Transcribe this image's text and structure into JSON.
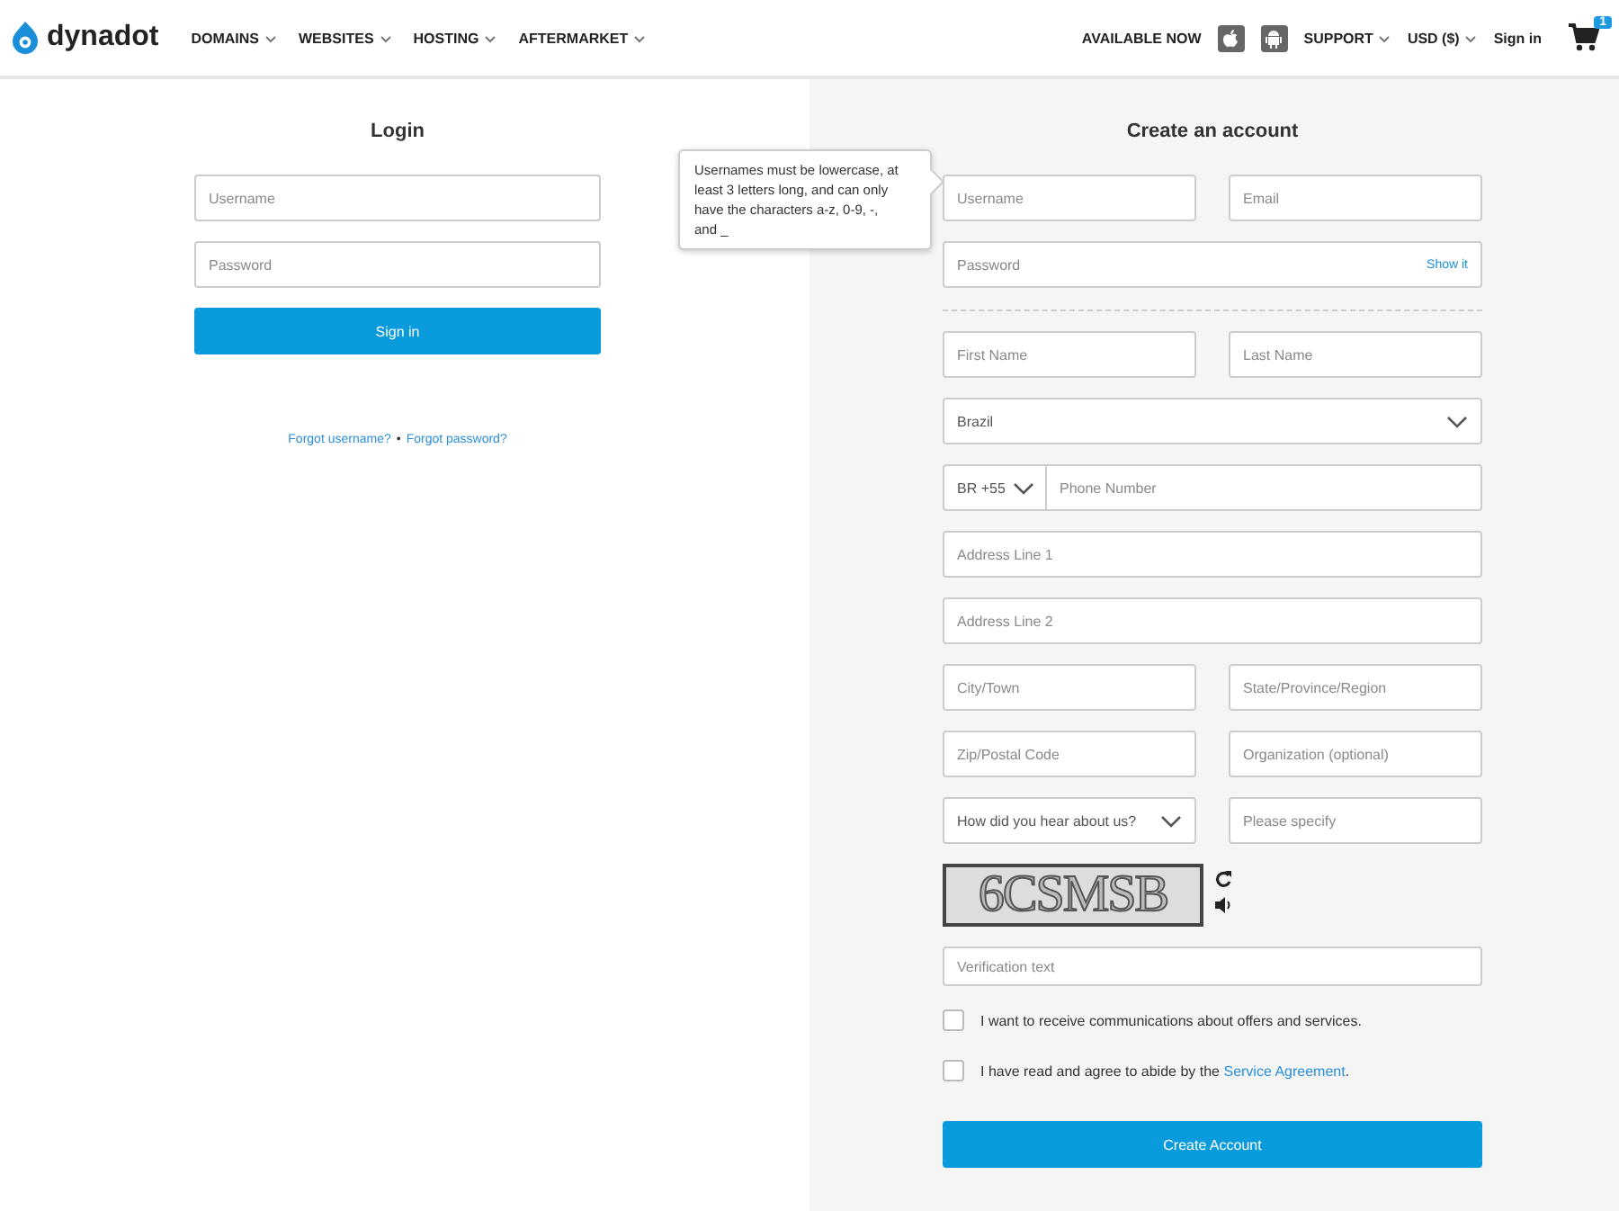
{
  "header": {
    "logo": "dynadot",
    "nav": [
      {
        "label": "DOMAINS"
      },
      {
        "label": "WEBSITES"
      },
      {
        "label": "HOSTING"
      },
      {
        "label": "AFTERMARKET"
      }
    ],
    "right": [
      {
        "kind": "text",
        "label": "AVAILABLE NOW"
      },
      {
        "kind": "apple"
      },
      {
        "kind": "android"
      },
      {
        "kind": "menu",
        "label": "SUPPORT"
      },
      {
        "kind": "menu",
        "label": "USD ($)"
      },
      {
        "kind": "link",
        "label": "Sign in"
      },
      {
        "kind": "cart",
        "count": "1"
      }
    ]
  },
  "login": {
    "title": "Login",
    "fields": [
      {
        "placeholder": "Username"
      },
      {
        "placeholder": "Password"
      }
    ],
    "button": "Sign in",
    "links": [
      "Forgot username?",
      "Forgot password?"
    ],
    "separator": "•"
  },
  "tooltip": "Usernames must be lowercase, at least 3 letters long, and can only have the characters a-z, 0-9, -, and _",
  "register": {
    "title": "Create an account",
    "rows": [
      [
        {
          "kind": "input",
          "placeholder": "Username"
        },
        {
          "kind": "input",
          "placeholder": "Email"
        }
      ],
      [
        {
          "kind": "password",
          "placeholder": "Password",
          "action": "Show it"
        }
      ],
      [
        {
          "kind": "divider"
        }
      ],
      [
        {
          "kind": "input",
          "placeholder": "First Name"
        },
        {
          "kind": "input",
          "placeholder": "Last Name"
        }
      ],
      [
        {
          "kind": "select",
          "value": "Brazil"
        }
      ],
      [
        {
          "kind": "phone",
          "code": "BR +55",
          "placeholder": "Phone Number"
        }
      ],
      [
        {
          "kind": "input",
          "placeholder": "Address Line 1"
        }
      ],
      [
        {
          "kind": "input",
          "placeholder": "Address Line 2"
        }
      ],
      [
        {
          "kind": "input",
          "placeholder": "City/Town"
        },
        {
          "kind": "input",
          "placeholder": "State/Province/Region"
        }
      ],
      [
        {
          "kind": "input",
          "placeholder": "Zip/Postal Code"
        },
        {
          "kind": "input",
          "placeholder": "Organization (optional)"
        }
      ],
      [
        {
          "kind": "select",
          "value": "How did you hear about us?"
        },
        {
          "kind": "input",
          "placeholder": "Please specify"
        }
      ]
    ],
    "captcha": "6CSMSB",
    "verification": {
      "placeholder": "Verification text"
    },
    "checks": [
      {
        "text": "I want to receive communications about offers and services.",
        "checked": false
      },
      {
        "text": "I have read and agree to abide by the",
        "link": "Service Agreement",
        "after": ".",
        "checked": false
      }
    ],
    "button": "Create Account"
  }
}
